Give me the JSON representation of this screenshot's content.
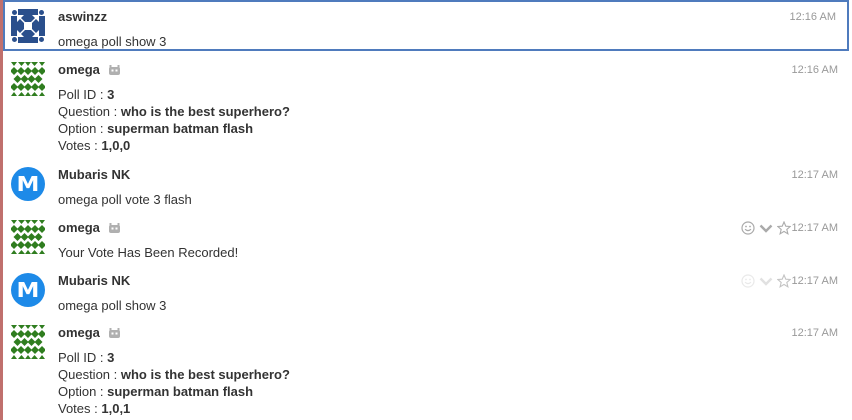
{
  "messages": [
    {
      "sender": "aswinzz",
      "time": "12:16 AM",
      "text": "omega poll show 3"
    },
    {
      "sender": "omega",
      "time": "12:16 AM",
      "poll": {
        "id_label": "Poll ID : ",
        "id_value": "3",
        "question_label": "Question : ",
        "question_value": "who is the best superhero?",
        "option_label": "Option : ",
        "option_value": "superman batman flash",
        "votes_label": "Votes : ",
        "votes_value": "1,0,0"
      }
    },
    {
      "sender": "Mubaris NK",
      "time": "12:17 AM",
      "avatar_letter": "M",
      "text": "omega poll vote 3 flash"
    },
    {
      "sender": "omega",
      "time": "12:17 AM",
      "text": "Your Vote Has Been Recorded!"
    },
    {
      "sender": "Mubaris NK",
      "time": "12:17 AM",
      "avatar_letter": "M",
      "text": "omega poll show 3"
    },
    {
      "sender": "omega",
      "time": "12:17 AM",
      "poll": {
        "id_label": "Poll ID : ",
        "id_value": "3",
        "question_label": "Question : ",
        "question_value": "who is the best superhero?",
        "option_label": "Option : ",
        "option_value": "superman batman flash",
        "votes_label": "Votes : ",
        "votes_value": "1,0,1"
      }
    }
  ],
  "colors": {
    "selected_border": "#4f7bbd",
    "left_bar": "#c0706d",
    "avatar_blue": "#1d8ae8",
    "identicon_green": "#2f7d1f",
    "identicon_blue": "#2a4f8c"
  },
  "icons": {
    "bot": "robot-icon",
    "emoji": "smiley-icon",
    "more": "chevron-down-icon",
    "star": "star-icon"
  }
}
